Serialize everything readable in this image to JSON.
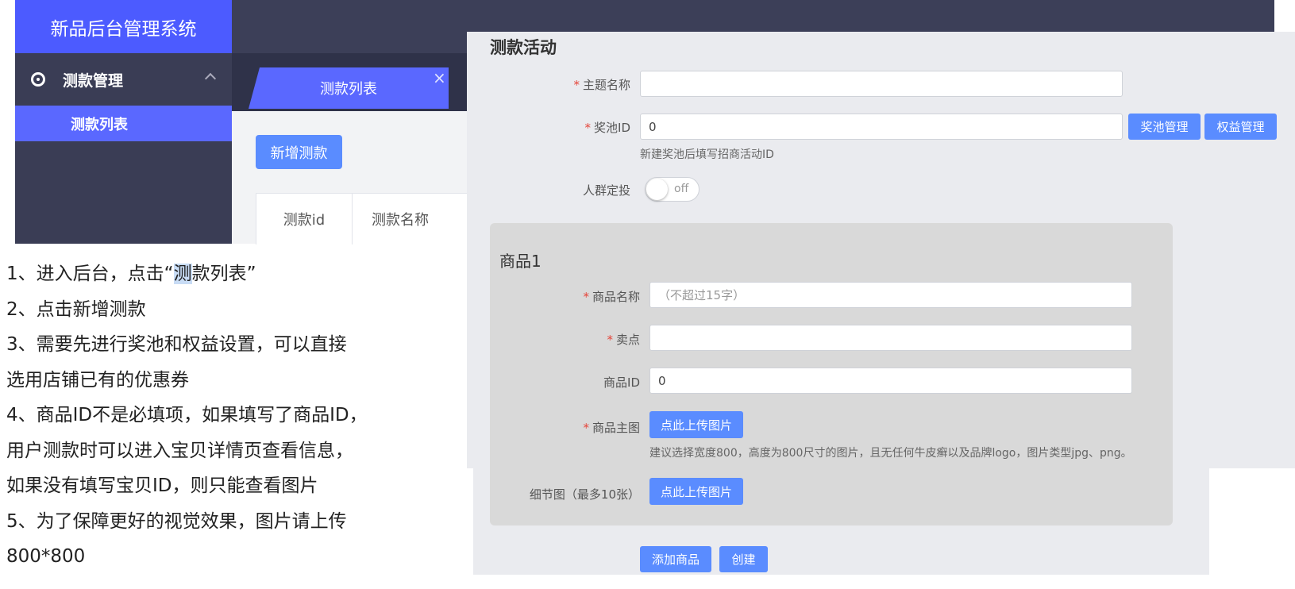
{
  "app_title": "新品后台管理系统",
  "sidebar": {
    "group_label": "测款管理",
    "item_label": "测款列表"
  },
  "tab": {
    "label": "测款列表",
    "close": "×"
  },
  "list": {
    "add_button": "新增测款",
    "columns": [
      "测款id",
      "测款名称"
    ]
  },
  "form": {
    "title": "测款活动",
    "theme_label": "主题名称",
    "theme_value": "",
    "pool_label": "奖池ID",
    "pool_value": "0",
    "pool_manage_button": "奖池管理",
    "rights_manage_button": "权益管理",
    "pool_hint": "新建奖池后填写招商活动ID",
    "crowd_label": "人群定投",
    "crowd_toggle": "off",
    "product": {
      "title": "商品1",
      "name_label": "商品名称",
      "name_placeholder": "（不超过15字）",
      "selling_point_label": "卖点",
      "selling_point_value": "",
      "id_label": "商品ID",
      "id_value": "0",
      "main_image_label": "商品主图",
      "upload_button": "点此上传图片",
      "main_image_hint": "建议选择宽度800，高度为800尺寸的图片，且无任何牛皮癣以及品牌logo，图片类型jpg、png。",
      "detail_label": "细节图（最多10张）",
      "detail_upload_button": "点此上传图片"
    },
    "add_product_button": "添加商品",
    "create_button": "创建"
  },
  "instructions": {
    "line1_pre": "1、进入后台，点击“",
    "line1_hl": "测",
    "line1_post": "款列表”",
    "line2": "2、点击新增测款",
    "line3": "3、需要先进行奖池和权益设置，可以直接",
    "line4": "选用店铺已有的优惠券",
    "line5": "4、商品ID不是必填项，如果填写了商品ID，",
    "line6": "用户测款时可以进入宝贝详情页查看信息，",
    "line7": "如果没有填写宝贝ID，则只能查看图片",
    "line8": "5、为了保障更好的视觉效果，图片请上传",
    "line9": "800*800"
  },
  "colors": {
    "accent": "#5a68ff",
    "logo_bg": "#4c5bff",
    "button": "#5a8cff",
    "required": "#e5453a",
    "dark_bg": "#3c3f58"
  }
}
